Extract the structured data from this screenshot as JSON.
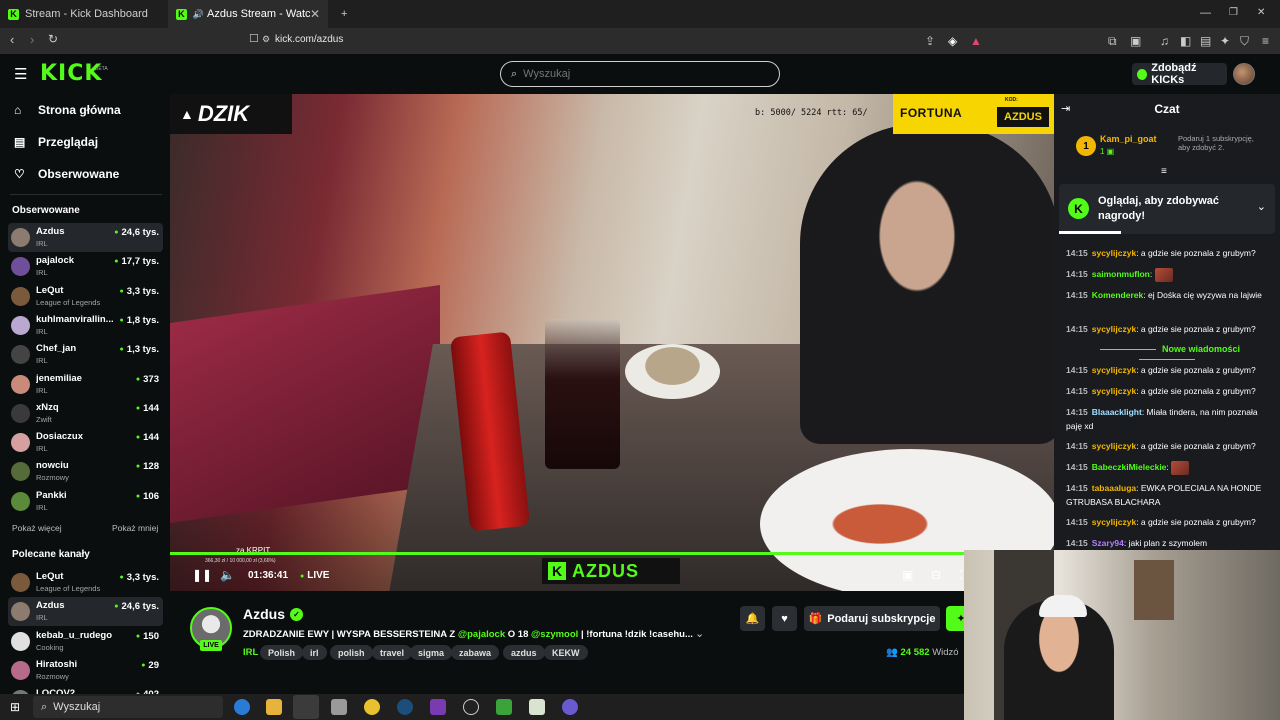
{
  "browser": {
    "tabs": [
      {
        "label": "Stream - Kick Dashboard"
      },
      {
        "label": "Azdus Stream - Watch Live o"
      }
    ],
    "url": "kick.com/azdus",
    "new_tab_glyph": "+",
    "window_controls": [
      "—",
      "❐",
      "✕"
    ]
  },
  "header": {
    "logo": "KICK",
    "logo_badge": "BETA",
    "search_placeholder": "Wyszukaj",
    "kicks_button": "Zdobądź KICKs"
  },
  "sidebar": {
    "nav": [
      {
        "label": "Strona główna",
        "icon": "home-icon"
      },
      {
        "label": "Przeglądaj",
        "icon": "browse-icon"
      },
      {
        "label": "Obserwowane",
        "icon": "heart-icon"
      }
    ],
    "followed_title": "Obserwowane",
    "followed": [
      {
        "name": "Azdus",
        "category": "IRL",
        "viewers": "24,6 tys.",
        "color": "#8c7b6e"
      },
      {
        "name": "pajalock",
        "category": "IRL",
        "viewers": "17,7 tys.",
        "color": "#6f4f9b"
      },
      {
        "name": "LeQut",
        "category": "League of Legends",
        "viewers": "3,3 tys.",
        "color": "#7a5a3a"
      },
      {
        "name": "kuhlmanvirallin...",
        "category": "IRL",
        "viewers": "1,8 tys.",
        "color": "#b9a9d0"
      },
      {
        "name": "Chef_jan",
        "category": "IRL",
        "viewers": "1,3 tys.",
        "color": "#444444"
      },
      {
        "name": "jenemiliae",
        "category": "IRL",
        "viewers": "373",
        "color": "#c98a7a"
      },
      {
        "name": "xNzq",
        "category": "Zwift",
        "viewers": "144",
        "color": "#3a3a3a"
      },
      {
        "name": "Dosiaczux",
        "category": "IRL",
        "viewers": "144",
        "color": "#d6a0a0"
      },
      {
        "name": "nowciu",
        "category": "Rozmowy",
        "viewers": "128",
        "color": "#556b3a"
      },
      {
        "name": "Pankki",
        "category": "IRL",
        "viewers": "106",
        "color": "#5a8a3a"
      }
    ],
    "show_more": "Pokaż więcej",
    "show_less": "Pokaż mniej",
    "recommended_title": "Polecane kanały",
    "recommended": [
      {
        "name": "LeQut",
        "category": "League of Legends",
        "viewers": "3,3 tys.",
        "color": "#7a5a3a"
      },
      {
        "name": "Azdus",
        "category": "IRL",
        "viewers": "24,6 tys.",
        "color": "#8c7b6e"
      },
      {
        "name": "kebab_u_rudego",
        "category": "Cooking",
        "viewers": "150",
        "color": "#e0e0e0"
      },
      {
        "name": "Hiratoshi",
        "category": "Rozmowy",
        "viewers": "29",
        "color": "#b86a8a"
      },
      {
        "name": "LOCOV2",
        "category": "",
        "viewers": "402",
        "color": "#777777"
      }
    ]
  },
  "player": {
    "brand_banner": "DZIK",
    "sponsor": "FORTUNA",
    "code_label": "KOD:",
    "code": "AZDUS",
    "stats_overlay": "b: 5000/ 5224 rtt: 65/",
    "goal_label": "za KRPIT",
    "goal_text": "366,30 zł / 10 000,00 zł (3,66%)",
    "goal_progress_pct": 3.66,
    "name_overlay": "AZDUS",
    "elapsed": "01:36:41",
    "live_label": "LIVE"
  },
  "stream": {
    "streamer": "Azdus",
    "live_badge": "LIVE",
    "title_prefix": "ZDRADZANIE EWY | WYSPA BESSERSTEINA Z",
    "mention1": "@pajalock",
    "title_mid": "O 18",
    "mention2": "@szymool",
    "title_suffix": "| !fortuna !dzik !casehu...",
    "category": "IRL",
    "tags": [
      "Polish",
      "irl",
      "polish",
      "travel",
      "sigma",
      "zabawa",
      "azdus",
      "KEKW"
    ],
    "gift_button": "Podaruj subskrypcje",
    "viewers_count": "24 582",
    "viewers_label": "Widzó"
  },
  "chat": {
    "title": "Czat",
    "pinned_user": "Kam_pi_goat",
    "pinned_rank": "1",
    "pinned_count": "1",
    "pinned_text": "Podaruj 1 subskrypcję, aby zdobyć 2.",
    "rewards_text": "Oglądaj, aby zdobywać nagrody!",
    "new_messages_label": "Nowe wiadomości",
    "messages_before": [
      {
        "time": "14:15",
        "user": "sycylijczyk",
        "color": "#f2b705",
        "text": ": a gdzie sie poznala z grubym?"
      },
      {
        "time": "14:15",
        "user": "saimonmuflon",
        "color": "#53fc18",
        "text": ":",
        "emote": true
      },
      {
        "time": "14:15",
        "user": "Komenderek",
        "color": "#53fc18",
        "text": ": ej Dośka cię wyzywa na lajwie"
      },
      {
        "time": "14:15",
        "user": "sycylijczyk",
        "color": "#f2b705",
        "text": ": a gdzie sie poznala z grubym?"
      }
    ],
    "messages_after": [
      {
        "time": "14:15",
        "user": "sycylijczyk",
        "color": "#f2b705",
        "text": ": a gdzie sie poznala z grubym?"
      },
      {
        "time": "14:15",
        "user": "sycylijczyk",
        "color": "#f2b705",
        "text": ": a gdzie sie poznala z grubym?"
      },
      {
        "time": "14:15",
        "user": "Blaaacklight",
        "color": "#a0e0ff",
        "text": ": Miała tindera, na nim poznała paję xd"
      },
      {
        "time": "14:15",
        "user": "sycylijczyk",
        "color": "#f2b705",
        "text": ": a gdzie sie poznala z grubym?"
      },
      {
        "time": "14:15",
        "user": "BabeczkiMieleckie",
        "color": "#53fc18",
        "text": ":",
        "emote": true
      },
      {
        "time": "14:15",
        "user": "tabaaaluga",
        "color": "#f2b705",
        "text": ": EWKA POLECIALA NA HONDE GTRUBASA BLACHARA"
      },
      {
        "time": "14:15",
        "user": "sycylijczyk",
        "color": "#f2b705",
        "text": ": a gdzie sie poznala z grubym?"
      },
      {
        "time": "14:15",
        "user": "Szary94",
        "color": "#b57cff",
        "text": ": jaki plan z szymolem"
      }
    ]
  },
  "taskbar": {
    "search": "Wyszukaj"
  }
}
